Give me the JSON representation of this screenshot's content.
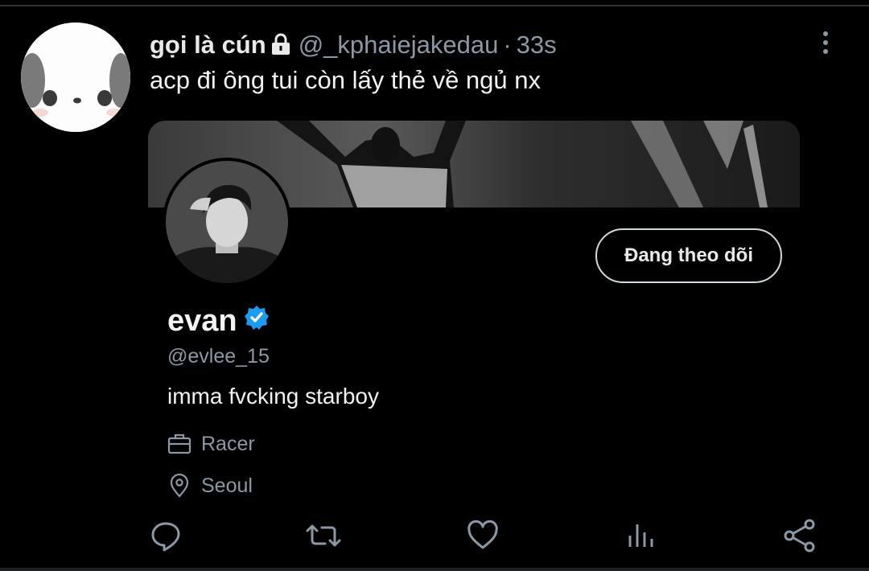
{
  "tweet": {
    "display_name": "gọi là cún",
    "handle": "@_kphaiejakedau",
    "separator": "·",
    "time": "33s",
    "text": "acp đi ông tui còn lấy thẻ về ngủ nx"
  },
  "profile_card": {
    "name": "evan",
    "handle": "@evlee_15",
    "bio": "imma fvcking starboy",
    "job": "Racer",
    "location": "Seoul",
    "follow_button_label": "Đang theo dõi"
  },
  "actions": [
    "reply-icon",
    "retweet-icon",
    "like-icon",
    "analytics-icon",
    "share-icon"
  ],
  "colors": {
    "background": "#000000",
    "text": "#e7e9ea",
    "muted": "#8b98a5",
    "verified": "#1d9bf0"
  }
}
